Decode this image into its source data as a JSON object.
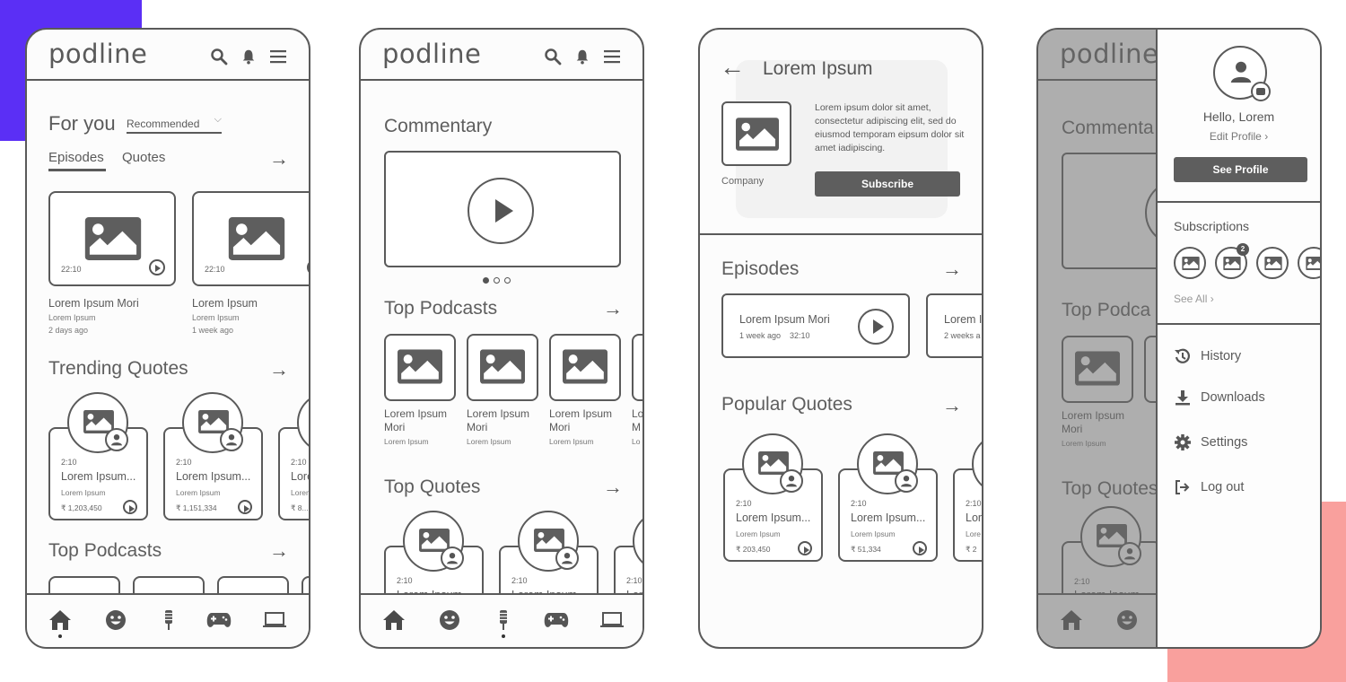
{
  "app": {
    "logo": "podline"
  },
  "colors": {
    "accent_purple": "#5b2ff5",
    "accent_pink": "#f9a09d",
    "wire": "#5a5a5a"
  },
  "icons": {
    "search": "search-icon",
    "bell": "bell-icon",
    "menu": "hamburger-icon",
    "arrow_right": "arrow-right-icon",
    "back": "arrow-left-icon",
    "play": "play-icon",
    "image": "image-placeholder-icon",
    "user": "user-icon",
    "camera": "camera-icon"
  },
  "nav": {
    "items": [
      "Home",
      "Comedy",
      "Microphone",
      "Games",
      "Tech"
    ]
  },
  "screen1": {
    "section_title": "For you",
    "filter_value": "Recommended",
    "tabs": [
      "Episodes",
      "Quotes"
    ],
    "active_tab": "Episodes",
    "episodes": [
      {
        "duration": "22:10",
        "title": "Lorem Ipsum Mori",
        "subtitle": "Lorem Ipsum",
        "age": "2 days ago"
      },
      {
        "duration": "22:10",
        "title": "Lorem Ipsum",
        "subtitle": "Lorem Ipsum",
        "age": "1 week ago"
      }
    ],
    "trending_title": "Trending Quotes",
    "quotes": [
      {
        "duration": "2:10",
        "title": "Lorem Ipsum...",
        "subtitle": "Lorem Ipsum",
        "count": "1,203,450"
      },
      {
        "duration": "2:10",
        "title": "Lorem Ipsum...",
        "subtitle": "Lorem Ipsum",
        "count": "1,151,334"
      },
      {
        "duration": "2:10",
        "title": "Lorem Ipsum...",
        "subtitle": "Lorem Ipsum",
        "count": "8..."
      }
    ],
    "top_podcasts_title": "Top Podcasts",
    "active_nav": "Home"
  },
  "screen2": {
    "commentary_title": "Commentary",
    "carousel_pages": 3,
    "carousel_active": 1,
    "top_podcasts_title": "Top Podcasts",
    "podcasts": [
      {
        "title_line1": "Lorem Ipsum",
        "title_line2": "Mori",
        "subtitle": "Lorem Ipsum"
      },
      {
        "title_line1": "Lorem Ipsum",
        "title_line2": "Mori",
        "subtitle": "Lorem Ipsum"
      },
      {
        "title_line1": "Lorem Ipsum",
        "title_line2": "Mori",
        "subtitle": "Lorem Ipsum"
      },
      {
        "title_line1": "Lo",
        "title_line2": "M",
        "subtitle": "Lo"
      }
    ],
    "top_quotes_title": "Top Quotes",
    "quotes": [
      {
        "duration": "2:10",
        "title": "Lorem Ipsum..."
      },
      {
        "duration": "2:10",
        "title": "Lorem Ipsum..."
      },
      {
        "duration": "2:10",
        "title": "Lor"
      }
    ],
    "active_nav": "Microphone"
  },
  "screen3": {
    "title": "Lorem Ipsum",
    "company_label": "Company",
    "description": "Lorem ipsum dolor sit amet, consectetur adipiscing elit, sed do eiusmod temporam eipsum dolor sit amet iadipiscing.",
    "subscribe_label": "Subscribe",
    "episodes_title": "Episodes",
    "episodes": [
      {
        "title": "Lorem Ipsum Mori",
        "age": "1 week ago",
        "duration": "32:10"
      },
      {
        "title": "Lorem I",
        "age": "2 weeks a",
        "duration": ""
      }
    ],
    "popular_quotes_title": "Popular Quotes",
    "quotes": [
      {
        "duration": "2:10",
        "title": "Lorem Ipsum...",
        "subtitle": "Lorem Ipsum",
        "count": "203,450"
      },
      {
        "duration": "2:10",
        "title": "Lorem Ipsum...",
        "subtitle": "Lorem Ipsum",
        "count": "51,334"
      },
      {
        "duration": "2:10",
        "title": "Lor",
        "subtitle": "Lore",
        "count": "2"
      }
    ]
  },
  "screen4": {
    "background": {
      "commentary_title": "Commenta",
      "top_podcasts_title": "Top Podca",
      "podcast": {
        "title_line1": "Lorem Ipsum",
        "title_line2": "Mori",
        "subtitle": "Lorem Ipsum"
      },
      "top_quotes_title": "Top Quotes",
      "quote": {
        "duration": "2:10",
        "title": "Lorem Ipsum..."
      }
    },
    "drawer": {
      "greeting": "Hello, Lorem",
      "edit_profile": "Edit Profile",
      "see_profile": "See Profile",
      "subscriptions_title": "Subscriptions",
      "subscription_badge": "2",
      "see_all": "See All",
      "menu": [
        {
          "label": "History",
          "icon": "history-icon"
        },
        {
          "label": "Downloads",
          "icon": "download-icon"
        },
        {
          "label": "Settings",
          "icon": "gear-icon"
        },
        {
          "label": "Log out",
          "icon": "logout-icon"
        }
      ]
    }
  }
}
